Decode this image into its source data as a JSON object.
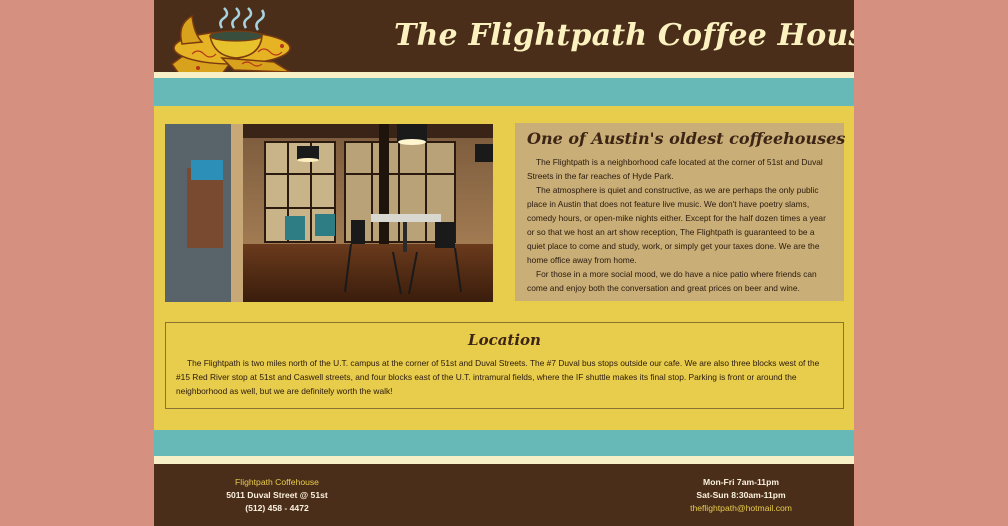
{
  "header": {
    "title": "The Flightpath Coffee House",
    "logo_icon": "coffee-cup-airplane-logo"
  },
  "about": {
    "heading": "One of Austin's oldest coffeehouses",
    "paragraphs": [
      "The Flightpath is a neighborhood cafe located at the corner of 51st and Duval Streets in the far reaches of Hyde Park.",
      "The atmosphere is quiet and constructive, as we are perhaps the only public place in Austin that does not feature live music. We don't have poetry slams, comedy hours, or open-mike nights either. Except for the half dozen times a year or so that we host an art show reception, The Flightpath is guaranteed to be a quiet place to come and study, work, or simply get your taxes done. We are the home office away from home.",
      "For those in a more social mood, we do have a nice patio where friends can come and enjoy both the conversation and great prices on beer and wine."
    ]
  },
  "location": {
    "heading": "Location",
    "text": "The Flightpath is two miles north of the U.T. campus at the corner of 51st and Duval Streets. The #7 Duval bus stops outside our cafe. We are also three blocks west of the #15 Red River stop at 51st and Caswell streets, and four blocks east of the U.T. intramural fields, where the IF shuttle makes its final stop. Parking is front or around the neighborhood as well, but we are definitely worth the walk!"
  },
  "footer": {
    "name": "Flightpath Coffehouse",
    "address": "5011 Duval Street @ 51st",
    "phone": "(512) 458 - 4472",
    "hours_weekday": "Mon-Fri 7am-11pm",
    "hours_weekend": "Sat-Sun 8:30am-11pm",
    "email": "theflightpath@hotmail.com"
  },
  "colors": {
    "background": "#d6907f",
    "brown": "#4a2e1a",
    "yellow": "#e8cc4c",
    "teal": "#67b9b7",
    "tan": "#c9ae78",
    "cream": "#fbf2c0"
  }
}
